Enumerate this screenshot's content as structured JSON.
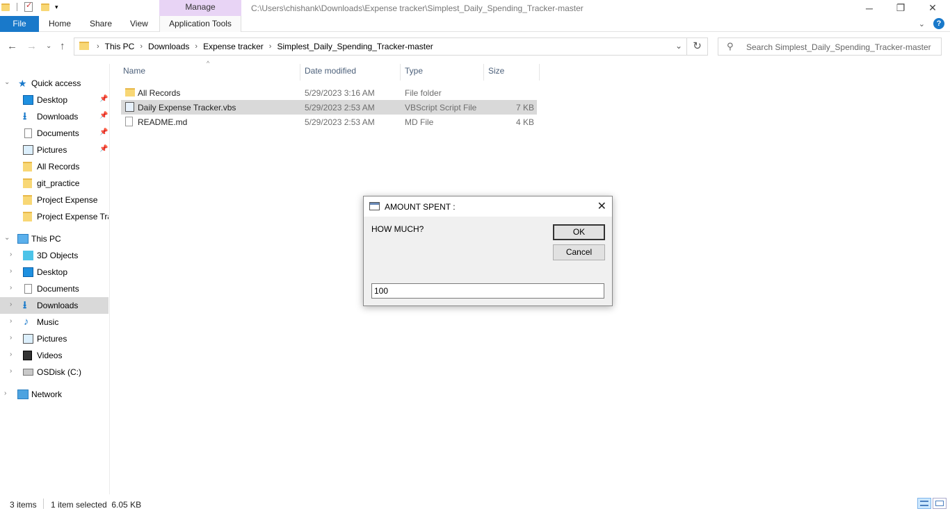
{
  "titlebar": {
    "manage_tab": "Manage",
    "path": "C:\\Users\\chishank\\Downloads\\Expense tracker\\Simplest_Daily_Spending_Tracker-master"
  },
  "ribbon": {
    "tabs": [
      "File",
      "Home",
      "Share",
      "View",
      "Application Tools"
    ]
  },
  "address": {
    "crumbs": [
      "This PC",
      "Downloads",
      "Expense tracker",
      "Simplest_Daily_Spending_Tracker-master"
    ],
    "search_placeholder": "Search Simplest_Daily_Spending_Tracker-master"
  },
  "navpane": {
    "quick_access": "Quick access",
    "quick_items": [
      "Desktop",
      "Downloads",
      "Documents",
      "Pictures",
      "All Records",
      "git_practice",
      "Project Expense",
      "Project Expense Tra"
    ],
    "this_pc": "This PC",
    "pc_items": [
      "3D Objects",
      "Desktop",
      "Documents",
      "Downloads",
      "Music",
      "Pictures",
      "Videos",
      "OSDisk (C:)"
    ],
    "network": "Network"
  },
  "filelist": {
    "columns": [
      "Name",
      "Date modified",
      "Type",
      "Size"
    ],
    "rows": [
      {
        "name": "All Records",
        "date": "5/29/2023 3:16 AM",
        "type": "File folder",
        "size": ""
      },
      {
        "name": "Daily Expense Tracker.vbs",
        "date": "5/29/2023 2:53 AM",
        "type": "VBScript Script File",
        "size": "7 KB"
      },
      {
        "name": "README.md",
        "date": "5/29/2023 2:53 AM",
        "type": "MD File",
        "size": "4 KB"
      }
    ]
  },
  "status": {
    "items": "3 items",
    "selected": "1 item selected  6.05 KB"
  },
  "dialog": {
    "title": "AMOUNT SPENT :",
    "prompt": "HOW MUCH?",
    "ok": "OK",
    "cancel": "Cancel",
    "input_value": "100"
  }
}
